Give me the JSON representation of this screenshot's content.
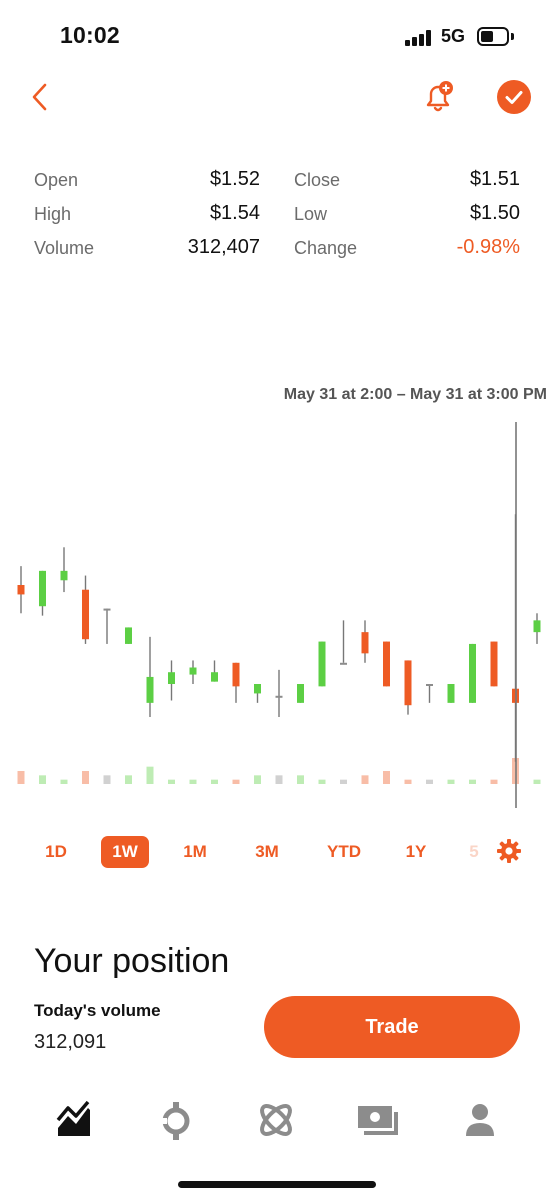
{
  "status_bar": {
    "time": "10:02",
    "network": "5G"
  },
  "header": {
    "back_icon": "chevron-left-icon",
    "alert_icon": "bell-plus-icon",
    "status_icon": "check-circle-icon"
  },
  "stats": [
    {
      "label_left": "Open",
      "value_left": "$1.52",
      "label_right": "Close",
      "value_right": "$1.51"
    },
    {
      "label_left": "High",
      "value_left": "$1.54",
      "label_right": "Low",
      "value_right": "$1.50"
    },
    {
      "label_left": "Volume",
      "value_left": "312,407",
      "label_right": "Change",
      "value_right": "-0.98%"
    }
  ],
  "chart": {
    "range_label": "May 31 at 2:00 – May 31 at 3:00 PM"
  },
  "chart_data": {
    "type": "candlestick",
    "ylim": [
      1.46,
      1.6
    ],
    "up_color": "#5ccf44",
    "down_color": "#ee5b24",
    "neutral_color": "#8c8c8c",
    "candles": [
      {
        "o": 1.53,
        "c": 1.526,
        "h": 1.538,
        "l": 1.518,
        "v": 3
      },
      {
        "o": 1.521,
        "c": 1.536,
        "h": 1.536,
        "l": 1.517,
        "v": 2
      },
      {
        "o": 1.532,
        "c": 1.536,
        "h": 1.546,
        "l": 1.527,
        "v": 1
      },
      {
        "o": 1.528,
        "c": 1.507,
        "h": 1.534,
        "l": 1.505,
        "v": 3
      },
      {
        "o": 1.52,
        "c": 1.52,
        "h": 1.52,
        "l": 1.505,
        "v": 2
      },
      {
        "o": 1.505,
        "c": 1.512,
        "h": 1.512,
        "l": 1.505,
        "v": 2
      },
      {
        "o": 1.48,
        "c": 1.491,
        "h": 1.508,
        "l": 1.474,
        "v": 4
      },
      {
        "o": 1.488,
        "c": 1.493,
        "h": 1.498,
        "l": 1.481,
        "v": 1
      },
      {
        "o": 1.492,
        "c": 1.495,
        "h": 1.498,
        "l": 1.488,
        "v": 1
      },
      {
        "o": 1.489,
        "c": 1.493,
        "h": 1.498,
        "l": 1.489,
        "v": 1
      },
      {
        "o": 1.497,
        "c": 1.487,
        "h": 1.497,
        "l": 1.48,
        "v": 1
      },
      {
        "o": 1.484,
        "c": 1.488,
        "h": 1.488,
        "l": 1.48,
        "v": 2
      },
      {
        "o": 1.483,
        "c": 1.483,
        "h": 1.494,
        "l": 1.474,
        "v": 2
      },
      {
        "o": 1.48,
        "c": 1.488,
        "h": 1.488,
        "l": 1.48,
        "v": 2
      },
      {
        "o": 1.487,
        "c": 1.506,
        "h": 1.506,
        "l": 1.487,
        "v": 1
      },
      {
        "o": 1.497,
        "c": 1.497,
        "h": 1.515,
        "l": 1.497,
        "v": 1
      },
      {
        "o": 1.51,
        "c": 1.501,
        "h": 1.515,
        "l": 1.497,
        "v": 2
      },
      {
        "o": 1.506,
        "c": 1.487,
        "h": 1.506,
        "l": 1.487,
        "v": 3
      },
      {
        "o": 1.498,
        "c": 1.479,
        "h": 1.498,
        "l": 1.475,
        "v": 1
      },
      {
        "o": 1.488,
        "c": 1.488,
        "h": 1.488,
        "l": 1.48,
        "v": 1
      },
      {
        "o": 1.48,
        "c": 1.488,
        "h": 1.488,
        "l": 1.48,
        "v": 1
      },
      {
        "o": 1.48,
        "c": 1.505,
        "h": 1.505,
        "l": 1.48,
        "v": 1
      },
      {
        "o": 1.506,
        "c": 1.487,
        "h": 1.506,
        "l": 1.487,
        "v": 1
      },
      {
        "o": 1.486,
        "c": 1.48,
        "h": 1.56,
        "l": 1.455,
        "v": 6
      },
      {
        "o": 1.51,
        "c": 1.515,
        "h": 1.518,
        "l": 1.505,
        "v": 1
      }
    ],
    "grid": false,
    "legend": "none"
  },
  "timeframes": [
    {
      "label": "1D",
      "active": false
    },
    {
      "label": "1W",
      "active": true
    },
    {
      "label": "1M",
      "active": false
    },
    {
      "label": "3M",
      "active": false
    },
    {
      "label": "YTD",
      "active": false
    },
    {
      "label": "1Y",
      "active": false
    },
    {
      "label": "5",
      "active": false
    }
  ],
  "settings_icon": "gear-icon",
  "position": {
    "title": "Your position",
    "volume_label": "Today's volume",
    "volume_value": "312,091",
    "trade_label": "Trade"
  },
  "nav": [
    {
      "name": "nav-chart",
      "icon": "chart-icon",
      "active": true
    },
    {
      "name": "nav-crypto",
      "icon": "crypto-icon",
      "active": false
    },
    {
      "name": "nav-explore",
      "icon": "atom-icon",
      "active": false
    },
    {
      "name": "nav-cash",
      "icon": "cash-icon",
      "active": false
    },
    {
      "name": "nav-account",
      "icon": "person-icon",
      "active": false
    }
  ],
  "accent_color": "#ee5b24"
}
